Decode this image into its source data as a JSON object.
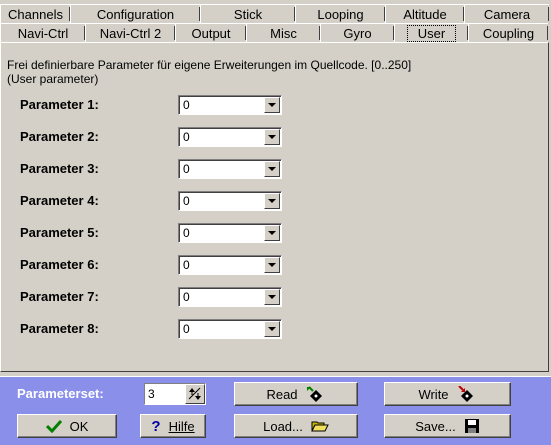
{
  "tabs_row1": [
    "Channels",
    "Configuration",
    "Stick",
    "Looping",
    "Altitude",
    "Camera"
  ],
  "tabs_row2": [
    "Navi-Ctrl",
    "Navi-Ctrl 2",
    "Output",
    "Misc",
    "Gyro",
    "User",
    "Coupling"
  ],
  "active_tab": "User",
  "description_line1": "Frei definierbare Parameter für eigene Erweiterungen im Quellcode. [0..250]",
  "description_line2": "(User parameter)",
  "parameters": [
    {
      "label": "Parameter 1:",
      "value": "0"
    },
    {
      "label": "Parameter 2:",
      "value": "0"
    },
    {
      "label": "Parameter 3:",
      "value": "0"
    },
    {
      "label": "Parameter 4:",
      "value": "0"
    },
    {
      "label": "Parameter 5:",
      "value": "0"
    },
    {
      "label": "Parameter 6:",
      "value": "0"
    },
    {
      "label": "Parameter 7:",
      "value": "0"
    },
    {
      "label": "Parameter 8:",
      "value": "0"
    }
  ],
  "bottom": {
    "parameterset_label": "Parameterset:",
    "parameterset_value": "3",
    "read_label": "Read",
    "write_label": "Write",
    "ok_label": "OK",
    "help_label": "Hilfe",
    "load_label": "Load...",
    "save_label": "Save..."
  },
  "colors": {
    "window_bg": "#d4d0c8",
    "bottom_bar_bg": "#8a8fe9"
  }
}
